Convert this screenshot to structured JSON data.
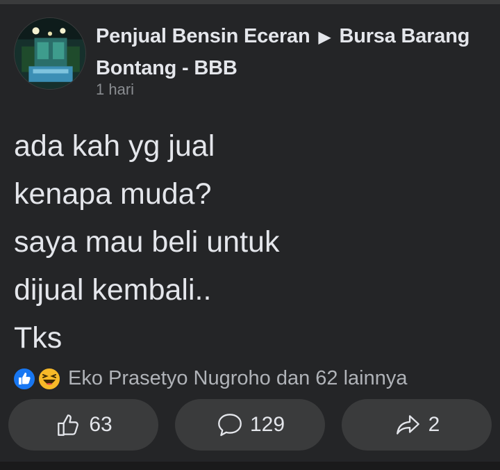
{
  "post": {
    "title": {
      "author": "Penjual Bensin Eceran",
      "arrow": "▶",
      "group": "Bursa Barang Bontang - BBB"
    },
    "timestamp": "1 hari",
    "body_lines": [
      "ada kah yg jual",
      "kenapa muda?",
      "saya mau beli untuk",
      "dijual kembali..",
      "Tks"
    ]
  },
  "reactions": {
    "icons": [
      "like-icon",
      "haha-icon"
    ],
    "summary": "Eko Prasetyo Nugroho dan 62 lainnya"
  },
  "actions": {
    "like_count": "63",
    "comment_count": "129",
    "share_count": "2"
  },
  "colors": {
    "background": "#242527",
    "button": "#3a3b3c",
    "text": "#e4e6eb",
    "muted": "#8a8d91",
    "like_blue": "#1877f2",
    "haha_yellow": "#f7b928"
  }
}
